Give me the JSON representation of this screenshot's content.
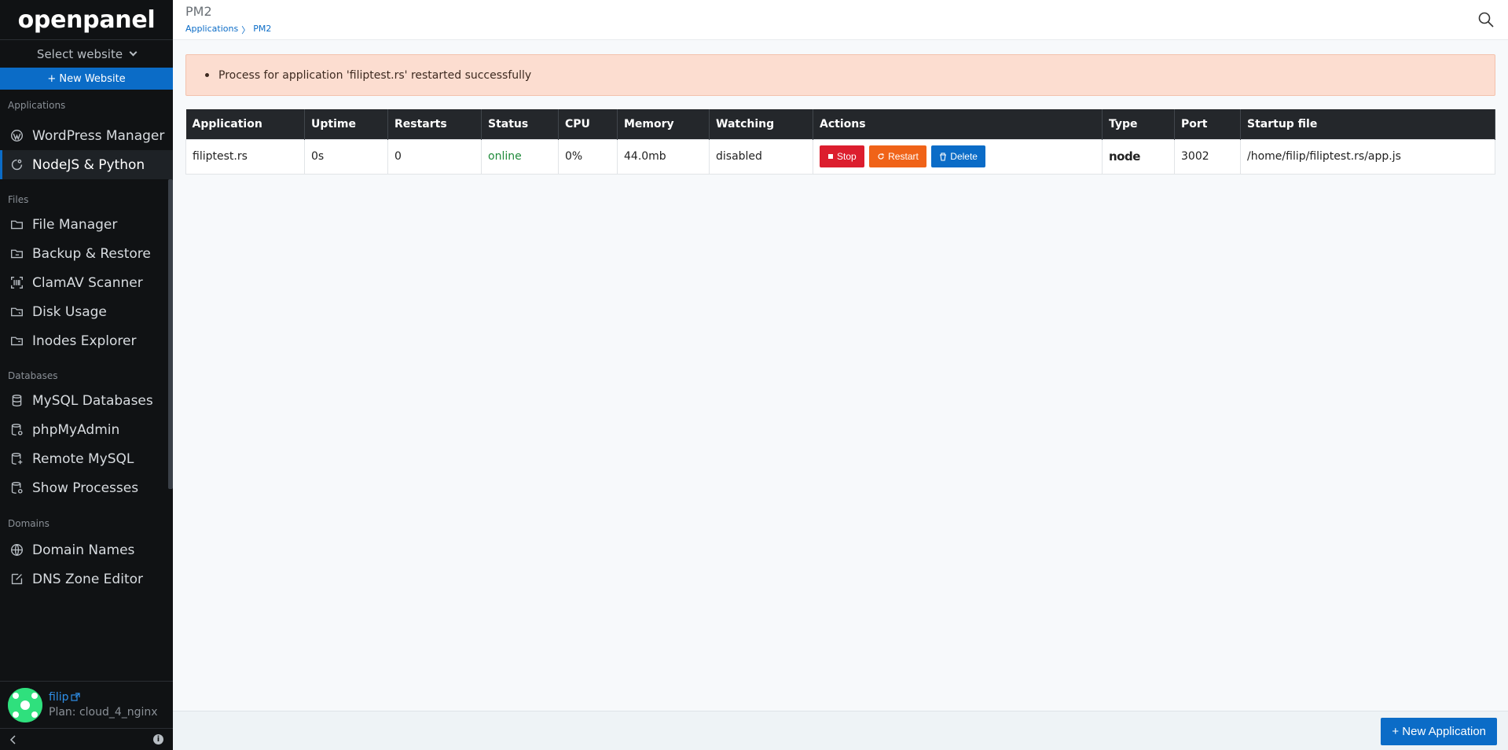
{
  "sidebar": {
    "logo": "openpanel",
    "select_website": "Select website",
    "new_website": "+ New Website",
    "sections": [
      {
        "title": "Applications",
        "items": [
          {
            "label": "WordPress Manager",
            "icon": "wordpress-icon"
          },
          {
            "label": "NodeJS & Python",
            "icon": "nodejs-icon",
            "active": true
          }
        ]
      },
      {
        "title": "Files",
        "items": [
          {
            "label": "File Manager",
            "icon": "folder-icon"
          },
          {
            "label": "Backup & Restore",
            "icon": "folder-backup-icon"
          },
          {
            "label": "ClamAV Scanner",
            "icon": "scanner-icon"
          },
          {
            "label": "Disk Usage",
            "icon": "folder-usage-icon"
          },
          {
            "label": "Inodes Explorer",
            "icon": "folder-inodes-icon"
          }
        ]
      },
      {
        "title": "Databases",
        "items": [
          {
            "label": "MySQL Databases",
            "icon": "database-icon"
          },
          {
            "label": "phpMyAdmin",
            "icon": "database-admin-icon"
          },
          {
            "label": "Remote MySQL",
            "icon": "database-remote-icon"
          },
          {
            "label": "Show Processes",
            "icon": "database-processes-icon"
          }
        ]
      },
      {
        "title": "Domains",
        "items": [
          {
            "label": "Domain Names",
            "icon": "globe-icon"
          },
          {
            "label": "DNS Zone Editor",
            "icon": "edit-icon"
          }
        ]
      }
    ],
    "user": {
      "name": "filip",
      "plan": "Plan: cloud_4_nginx"
    }
  },
  "header": {
    "title": "PM2",
    "breadcrumb": [
      "Applications",
      "PM2"
    ],
    "breadcrumb_sep": "〉"
  },
  "alert": {
    "message": "Process for application 'filiptest.rs' restarted successfully"
  },
  "table": {
    "columns": [
      "Application",
      "Uptime",
      "Restarts",
      "Status",
      "CPU",
      "Memory",
      "Watching",
      "Actions",
      "Type",
      "Port",
      "Startup file"
    ],
    "rows": [
      {
        "application": "filiptest.rs",
        "uptime": "0s",
        "restarts": "0",
        "status": "online",
        "cpu": "0%",
        "memory": "44.0mb",
        "watching": "disabled",
        "actions": {
          "stop": "Stop",
          "restart": "Restart",
          "delete": "Delete"
        },
        "type": "node",
        "port": "3002",
        "startup_file": "/home/filip/filiptest.rs/app.js"
      }
    ]
  },
  "footer": {
    "new_application": "+ New Application"
  },
  "colors": {
    "accent": "#0b6cc7",
    "stop": "#dc1e2e",
    "restart": "#f06318",
    "online": "#1f8a3a",
    "alert_bg": "#fcddd0"
  }
}
